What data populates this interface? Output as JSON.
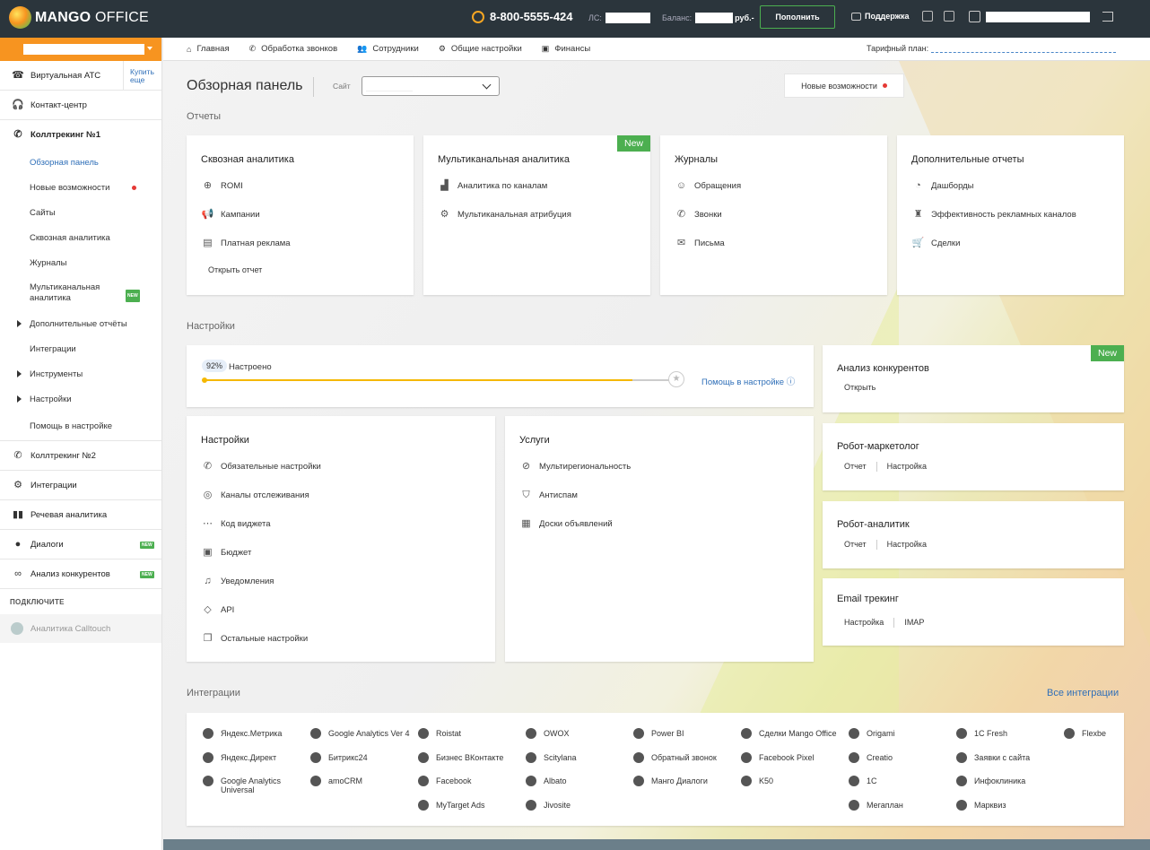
{
  "topbar": {
    "logo_brand": "MANGO",
    "logo_product": "OFFICE",
    "phone": "8-800-5555-424",
    "ls_label": "ЛС:",
    "balance_label": "Баланс:",
    "balance_currency": "руб.-",
    "topup_label": "Пополнить",
    "support_label": "Поддержка"
  },
  "subnav": {
    "items": [
      {
        "label": "Главная",
        "icon": "home-icon"
      },
      {
        "label": "Обработка звонков",
        "icon": "phone-icon"
      },
      {
        "label": "Сотрудники",
        "icon": "users-icon"
      },
      {
        "label": "Общие настройки",
        "icon": "gear-icon"
      },
      {
        "label": "Финансы",
        "icon": "wallet-icon"
      }
    ],
    "tariff_label": "Тарифный план:"
  },
  "sidebar": {
    "sections": [
      {
        "label": "Виртуальная АТС",
        "buy": "Купить еще"
      },
      {
        "label": "Контакт-центр"
      },
      {
        "label": "Коллтрекинг №1"
      }
    ],
    "sub_items": [
      {
        "label": "Обзорная панель"
      },
      {
        "label": "Новые возможности"
      },
      {
        "label": "Сайты"
      },
      {
        "label": "Сквозная аналитика"
      },
      {
        "label": "Журналы"
      },
      {
        "label": "Мультиканальная аналитика"
      },
      {
        "label": "Дополнительные отчёты"
      },
      {
        "label": "Интеграции"
      },
      {
        "label": "Инструменты"
      },
      {
        "label": "Настройки"
      },
      {
        "label": "Помощь в настройке"
      }
    ],
    "bottom_sections": [
      {
        "label": "Коллтрекинг №2"
      },
      {
        "label": "Интеграции"
      },
      {
        "label": "Речевая аналитика"
      },
      {
        "label": "Диалоги"
      },
      {
        "label": "Анализ конкурентов"
      }
    ],
    "connect_label": "ПОДКЛЮЧИТЕ",
    "calltouch_label": "Аналитика Calltouch",
    "new_badge": "NEW"
  },
  "main": {
    "title": "Обзорная панель",
    "site_label": "Сайт",
    "new_features": "Новые возможности",
    "reports_label": "Отчеты",
    "settings_label": "Настройки",
    "integrations_label": "Интеграции",
    "all_integrations": "Все интеграции",
    "new_tag": "New"
  },
  "reports": [
    {
      "title": "Сквозная аналитика",
      "items": [
        "ROMI",
        "Кампании",
        "Платная реклама"
      ],
      "link": "Открыть отчет"
    },
    {
      "title": "Мультиканальная аналитика",
      "items": [
        "Аналитика по каналам",
        "Мультиканальная атрибуция"
      ]
    },
    {
      "title": "Журналы",
      "items": [
        "Обращения",
        "Звонки",
        "Письма"
      ]
    },
    {
      "title": "Дополнительные отчеты",
      "items": [
        "Дашборды",
        "Эффективность рекламных каналов",
        "Сделки"
      ]
    }
  ],
  "progress": {
    "percent_label": "92%",
    "value": 0.92,
    "label": "Настроено",
    "help": "Помощь в настройке"
  },
  "settings_card": {
    "title": "Настройки",
    "items": [
      "Обязательные настройки",
      "Каналы отслеживания",
      "Код виджета",
      "Бюджет",
      "Уведомления",
      "API",
      "Остальные настройки"
    ]
  },
  "services_card": {
    "title": "Услуги",
    "items": [
      "Мультирегиональность",
      "Антиспам",
      "Доски объявлений"
    ]
  },
  "right_cards": {
    "competitors": {
      "title": "Анализ конкурентов",
      "link": "Открыть"
    },
    "robot_marketer": {
      "title": "Робот-маркетолог",
      "links": [
        "Отчет",
        "Настройка"
      ]
    },
    "robot_analyst": {
      "title": "Робот-аналитик",
      "links": [
        "Отчет",
        "Настройка"
      ]
    },
    "email": {
      "title": "Email трекинг",
      "links": [
        "Настройка",
        "IMAP"
      ]
    }
  },
  "integrations": {
    "columns": [
      [
        "Яндекс.Метрика",
        "Яндекс.Директ",
        "Google Analytics Universal"
      ],
      [
        "Google Analytics Ver 4",
        "Битрикс24",
        "amoCRM"
      ],
      [
        "Roistat",
        "Бизнес ВКонтакте",
        "Facebook",
        "MyTarget Ads"
      ],
      [
        "OWOX",
        "Scitylana",
        "Albato",
        "Jivosite"
      ],
      [
        "Power BI",
        "Обратный звонок",
        "Манго Диалоги"
      ],
      [
        "Сделки Mango Office",
        "Facebook Pixel",
        "K50"
      ],
      [
        "Origami",
        "Creatio",
        "1С",
        "Мегаплан"
      ],
      [
        "1C Fresh",
        "Заявки с сайта",
        "Инфоклиника",
        "Марквиз"
      ],
      [
        "Flexbe"
      ]
    ]
  }
}
